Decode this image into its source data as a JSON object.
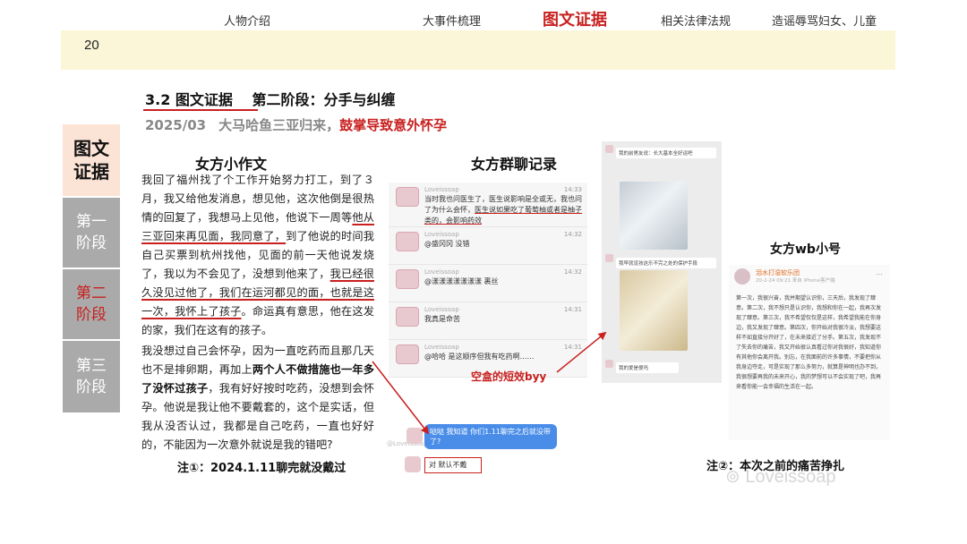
{
  "page_number": "20",
  "nav": {
    "items": [
      "人物介绍",
      "大事件梳理",
      "图文证据",
      "相关法律法规",
      "造谣辱骂妇女、儿童"
    ],
    "active_index": 2
  },
  "section": {
    "title": "3.2 图文证据　 第二阶段：分手与纠缠",
    "date": "2025/03",
    "subtitle_gray": "大马哈鱼三亚归来，",
    "subtitle_red": "鼓掌导致意外怀孕"
  },
  "sidebar": {
    "tabs": [
      "图文证据",
      "第一阶段",
      "第二阶段",
      "第三阶段"
    ]
  },
  "essay": {
    "title": "女方小作文",
    "p1_a": "我回了福州找了个工作开始努力打工，到了３月，我又给他发消息，想见他，这次他倒是很热情的回复了，我想马上见他，他说下一周等",
    "p1_ul1": "他从三亚回来再见面，我同意了，",
    "p1_b": "到了他说的时间我自己买票到杭州找他，见面的前一天他说发烧了，我以为不会见了，没想到他来了，",
    "p1_ul2": "我已经很久没见过他了，我们在运河都见的面，也就是这一次，我怀上了孩子",
    "p1_c": "。命运真有意思，他在这发的家，我们在这有的孩子。",
    "p2_a": "我没想过自己会怀孕，因为一直吃药而且那几天也不是排卵期，再加上",
    "p2_bold1": "两个人不做措施也一年多了没怀过孩子",
    "p2_b": "，我有好好按时吃药，没想到会怀孕。他说是我让他不要戴套的，这个是实话，但我从没否认过，我都是自己吃药，一直也好好的，不能因为一次意外就说是我的错吧?"
  },
  "notes": {
    "note1": "注①：2024.1.11聊完就没戴过",
    "note2": "注②：本次之前的痛苦挣扎"
  },
  "group_chat": {
    "title": "女方群聊记录",
    "messages": [
      {
        "name": "Loveissoap",
        "time": "14:33",
        "text_a": "当时我也问医生了，医生说影响是全或无，我也问了为什么会怀，",
        "text_ul": "医生说如果吃了葡萄柚或者是柚子类的，会影响药效"
      },
      {
        "name": "Loveissoap",
        "time": "14:32",
        "text_a": "@盛冈冈 没错",
        "text_ul": ""
      },
      {
        "name": "Loveissoap",
        "time": "14:32",
        "text_a": "@漾漾漾漾漾漾漾 裹丝",
        "text_ul": ""
      },
      {
        "name": "Loveissoap",
        "time": "14:31",
        "text_a": "我真是命苦",
        "text_ul": ""
      },
      {
        "name": "Loveissoap",
        "time": "14:31",
        "text_a": "@哈哈 是这顺序但我有吃药啊……",
        "text_ul": ""
      }
    ],
    "bubble": "哒哒 我知道 你们1.11聊完之后就没带了?",
    "reply": "对 默认不戴",
    "small_watermark": "@Loveissoap",
    "box_label": "空盒的短效byy"
  },
  "phone": {
    "top_msg": "我的前男友说：长大基本全好运吧",
    "mid_msg": "我早就没孩这乐不完之处的保护手段",
    "bottom_msg": "我的爱是傻吗"
  },
  "weibo": {
    "title": "女方wb小号",
    "name": "泪水打湿软乐团",
    "meta": "20-2-24 09:21 来自 iPhone客户端",
    "more": "⋯",
    "body": "第一次，我很兴奋，我并期望认识你，三天后，我发现了肆意。第二次，我不想只是认识你，我想和你在一起，我再次发现了肆意。第三次，我不希望仅仅是这样，我希望我能在你身边，我又发现了肆意。第四次，你开始对我很冷淡，我想要这样不如直接分开好了，在未来接近了分手。第五次，我发现不了失去你的痛苦，我又开始很认真看过你对我很好，我知道你有其他你会离开我。别忘，在我面前的许多事情，不要把你从我身边夺走，可是实现了那么多努力，就算是神明也办不到，我很想要再我的未来开心，我的梦想可以不会实现了吧，我再来看你能一会幸福的生活在一起。"
  },
  "watermark": "Loveissoap",
  "colors": {
    "accent_red": "#c8201f",
    "nav_bg": "#fbf6d8",
    "tab_active_bg": "#fbe3d6",
    "tab_bg": "#aaaaaa"
  }
}
